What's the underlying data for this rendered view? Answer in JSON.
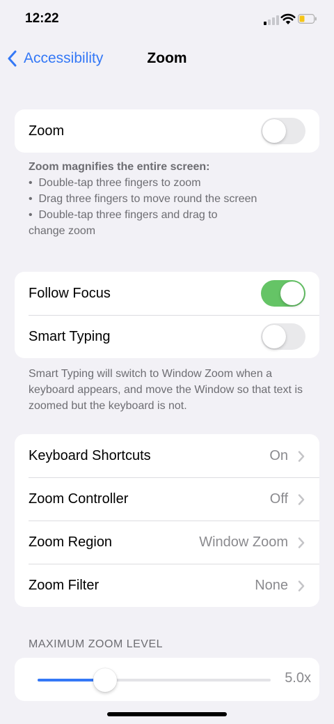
{
  "status_bar": {
    "time": "12:22",
    "signal_bars_active": 1,
    "battery_color": "#f5c518"
  },
  "nav": {
    "back_label": "Accessibility",
    "title": "Zoom",
    "accent_color": "#3478f6"
  },
  "zoom_group": {
    "label": "Zoom",
    "enabled": false
  },
  "zoom_footer": {
    "heading": "Zoom magnifies the entire screen:",
    "bullets": [
      "Double-tap three fingers to zoom",
      "Drag three fingers to move round the screen",
      "Double-tap three fingers and drag to"
    ],
    "continuation": "change zoom"
  },
  "focus_group": {
    "follow_focus_label": "Follow Focus",
    "follow_focus_enabled": true,
    "smart_typing_label": "Smart Typing",
    "smart_typing_enabled": false
  },
  "smart_typing_footer": "Smart Typing will switch to Window Zoom when a keyboard appears, and move the Window so that text is zoomed but the keyboard is not.",
  "options_group": [
    {
      "label": "Keyboard Shortcuts",
      "value": "On"
    },
    {
      "label": "Zoom Controller",
      "value": "Off"
    },
    {
      "label": "Zoom Region",
      "value": "Window Zoom"
    },
    {
      "label": "Zoom Filter",
      "value": "None"
    }
  ],
  "max_zoom": {
    "header": "MAXIMUM ZOOM LEVEL",
    "value_text": "5.0x",
    "level_fraction": 0.29
  },
  "colors": {
    "toggle_on": "#65c466",
    "toggle_off": "#e9e9eb",
    "background": "#f2f1f6"
  }
}
